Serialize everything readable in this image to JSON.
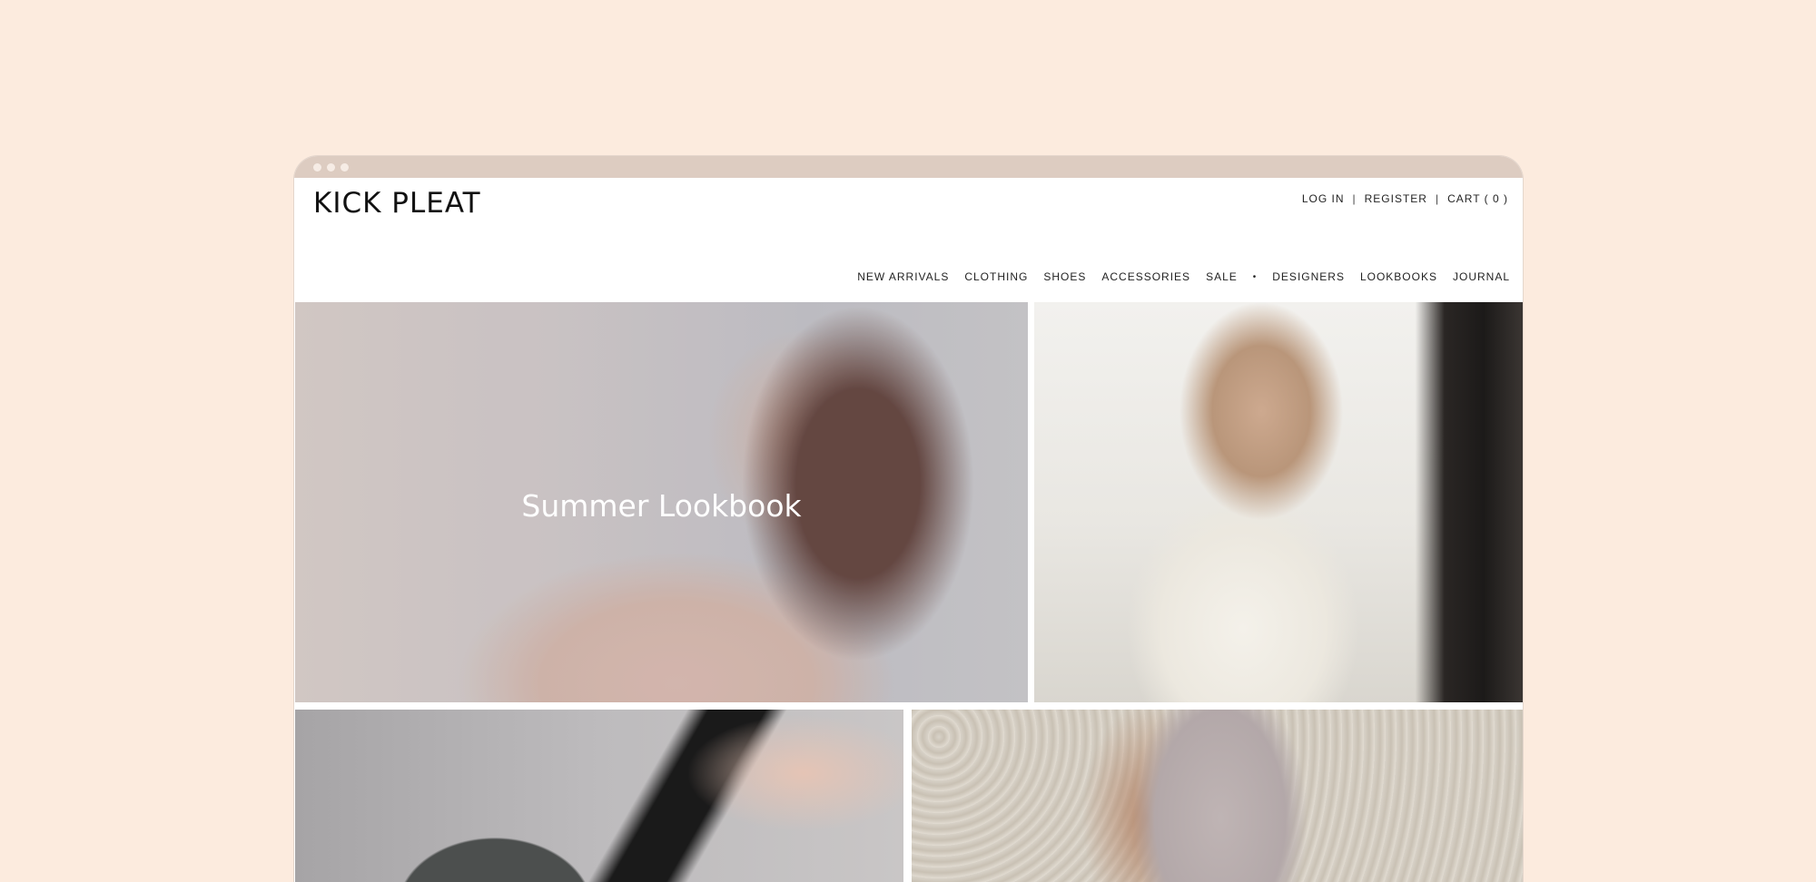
{
  "window": {
    "dots": [
      "",
      "",
      ""
    ]
  },
  "header": {
    "logo": "KICK PLEAT",
    "account": {
      "login": "LOG IN",
      "separator": "|",
      "register": "REGISTER",
      "cart": "CART ( 0 )"
    },
    "nav": [
      "NEW ARRIVALS",
      "CLOTHING",
      "SHOES",
      "ACCESSORIES",
      "SALE",
      "DESIGNERS",
      "LOOKBOOKS",
      "JOURNAL"
    ],
    "nav_divider": "•"
  },
  "hero": {
    "lookbook_title": "Summer Lookbook"
  },
  "colors": {
    "page_background": "#fcebde",
    "chrome_bar": "#ddccc1",
    "text": "#111111"
  }
}
